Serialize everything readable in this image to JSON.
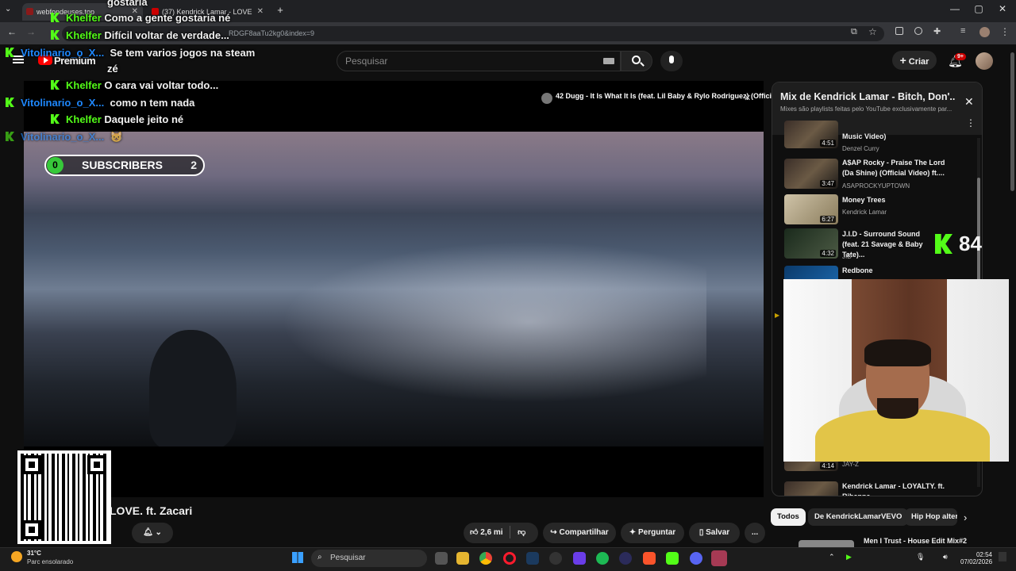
{
  "browser": {
    "tabs": [
      {
        "label": "webfondeuses.top"
      },
      {
        "label": "(37) Kendrick Lamar - LOVE"
      }
    ],
    "url": "RDGF8aaTu2kg0&index=9",
    "new_tab": "+",
    "minimize": "—",
    "maximize": "▢",
    "close": "✕"
  },
  "youtube": {
    "logo_text": "Premium",
    "search_placeholder": "Pesquisar",
    "create_label": "Criar",
    "notif_badge": "9+",
    "video_title": "LOVE. ft. Zacari",
    "next_up": "42 Dugg - It Is What It Is (feat. Lil Baby & Rylo Rodriguez) (Offici...",
    "likes": "2,6 mi",
    "share": "Compartilhar",
    "ask": "Perguntar",
    "save": "Salvar",
    "more": "..."
  },
  "subscribers": {
    "left": "0",
    "label": "SUBSCRIBERS",
    "right": "2"
  },
  "chat": [
    {
      "user": "",
      "text": "gostaria",
      "color": "green"
    },
    {
      "user": "Khelfer",
      "text": "Como a gente gostaria né",
      "color": "green"
    },
    {
      "user": "Khelfer",
      "text": "Difícil voltar de verdade...",
      "color": "green"
    },
    {
      "user": "Vitolinario_o_X...",
      "text": "Se tem varios jogos na steam",
      "color": "blue"
    },
    {
      "user": "",
      "text": "zé",
      "color": "blue"
    },
    {
      "user": "Khelfer",
      "text": "O cara vai voltar todo...",
      "color": "green"
    },
    {
      "user": "Vitolinario_o_X...",
      "text": "como n tem nada",
      "color": "blue"
    },
    {
      "user": "Khelfer",
      "text": "Daquele jeito né",
      "color": "green"
    },
    {
      "user": "Vitolinario_o_X...",
      "text": "😺",
      "color": "blue"
    }
  ],
  "playlist": {
    "title": "Mix de Kendrick Lamar - Bitch, Don'...",
    "subtitle": "Mixes são playlists feitas pelo YouTube exclusivamente par...",
    "items": [
      {
        "title": "Music Video)",
        "channel": "Denzel Curry",
        "duration": "4:51"
      },
      {
        "title": "A$AP Rocky - Praise The Lord (Da Shine) (Official Video) ft....",
        "channel": "ASAPROCKYUPTOWN",
        "duration": "3:47"
      },
      {
        "title": "Money Trees",
        "channel": "Kendrick Lamar",
        "duration": "6:27"
      },
      {
        "title": "J.I.D - Surround Sound (feat. 21 Savage & Baby Tate)...",
        "channel": "JID",
        "duration": "4:32"
      },
      {
        "title": "Redbone",
        "channel": "",
        "duration": ""
      },
      {
        "title": "",
        "channel": "JAY-Z",
        "duration": "4:14"
      },
      {
        "title": "Kendrick Lamar - LOYALTY. ft. Rihanna",
        "channel": "",
        "duration": ""
      }
    ]
  },
  "chips": [
    "Todos",
    "De KendrickLamarVEVO",
    "Hip Hop alter"
  ],
  "rec_next": "Men I Trust - House Edit Mix#2",
  "kick_count": "84",
  "taskbar": {
    "weather_temp": "31°C",
    "weather_desc": "Parc ensolarado",
    "search": "Pesquisar",
    "time": "02:54",
    "date": "07/02/2026"
  }
}
